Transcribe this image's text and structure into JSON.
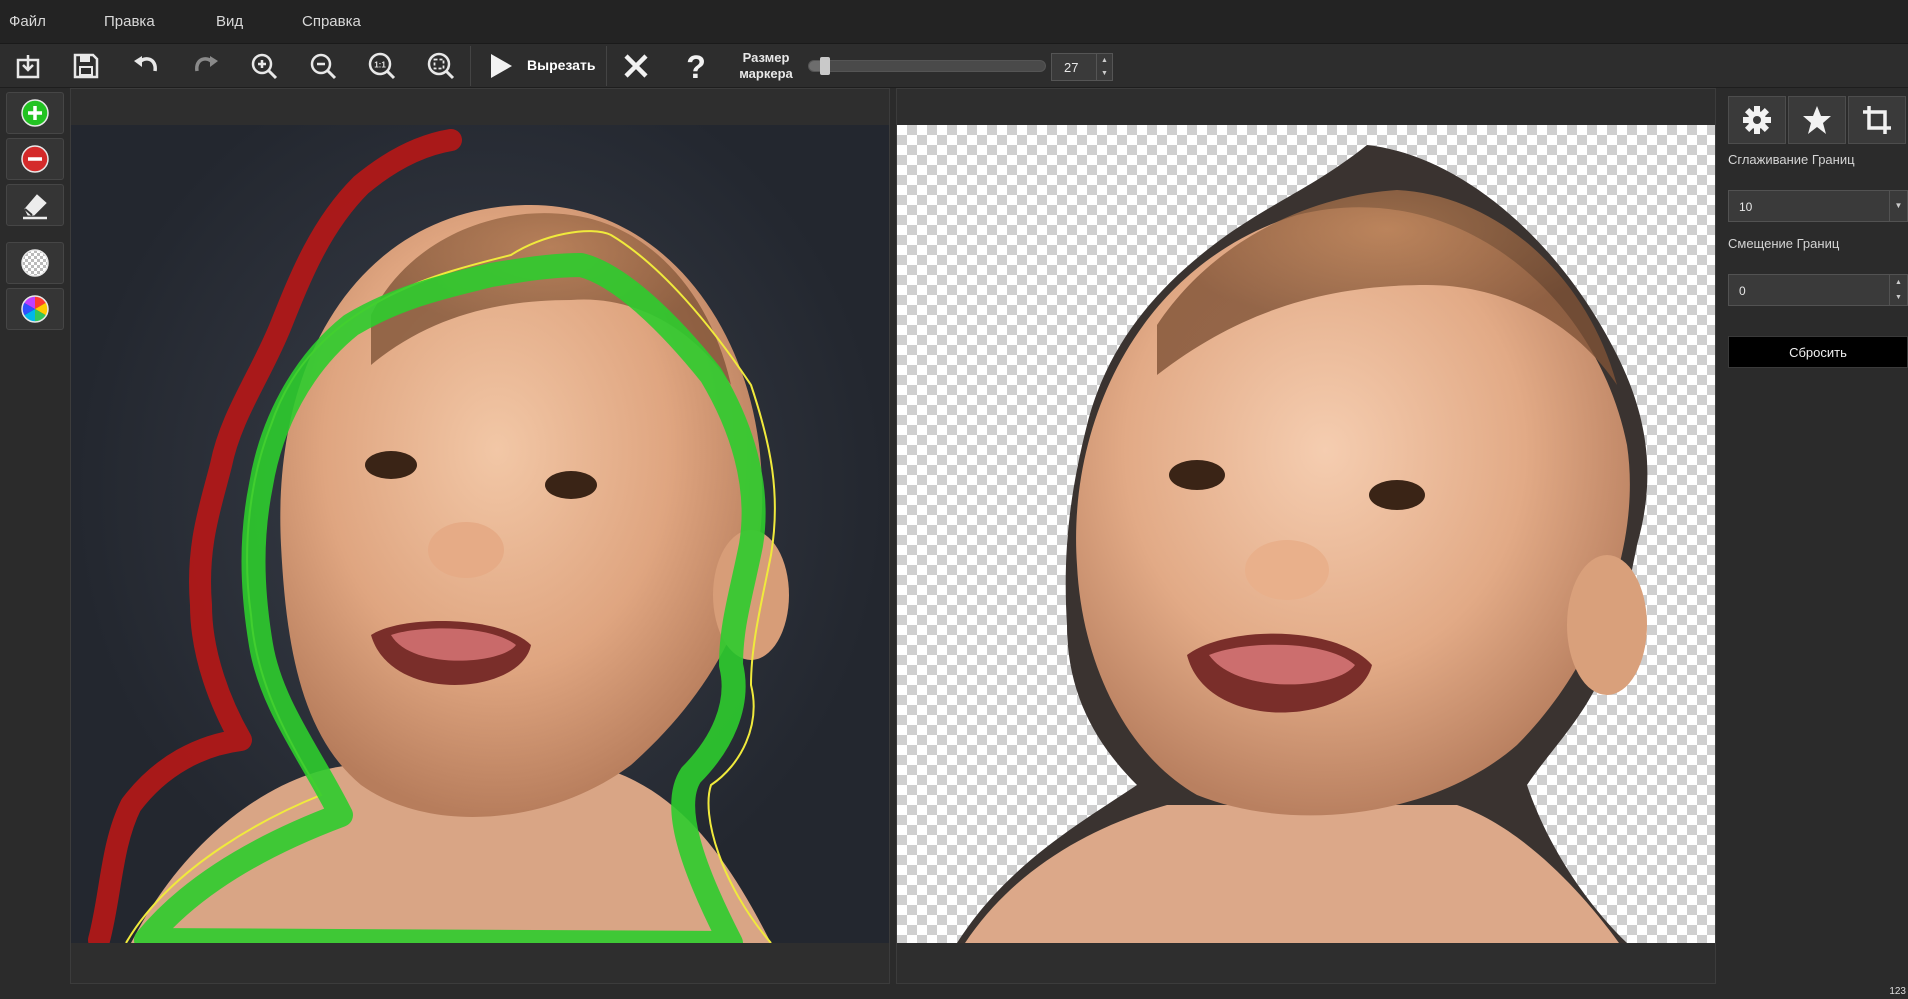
{
  "menu": {
    "file": "Файл",
    "edit": "Правка",
    "view": "Вид",
    "help": "Справка"
  },
  "toolbar": {
    "cut_label": "Вырезать",
    "marker_size_label": "Размер маркера",
    "marker_size_value": "27",
    "marker_size_fraction": 0.03,
    "icons": [
      "import-icon",
      "save-icon",
      "undo-icon",
      "redo-icon",
      "zoom-in-icon",
      "zoom-out-icon",
      "zoom-1-1-icon",
      "fit-screen-icon",
      "play-icon",
      "close-icon",
      "help-icon"
    ]
  },
  "palette": {
    "icons": [
      "add-area-icon",
      "remove-area-icon",
      "eraser-icon",
      "transparent-bg-icon",
      "color-wheel-icon"
    ]
  },
  "side": {
    "tabs": [
      "gear-icon",
      "star-icon",
      "crop-icon"
    ],
    "smoothing_label": "Сглаживание Границ",
    "smoothing_value": "10",
    "offset_label": "Смещение Границ",
    "offset_value": "0",
    "reset_label": "Сбросить"
  },
  "status": {
    "corner_text": "123"
  },
  "colors": {
    "keep_stroke": "#2ecc2e",
    "remove_stroke": "#b01818",
    "outline": "#f0ea3c"
  }
}
